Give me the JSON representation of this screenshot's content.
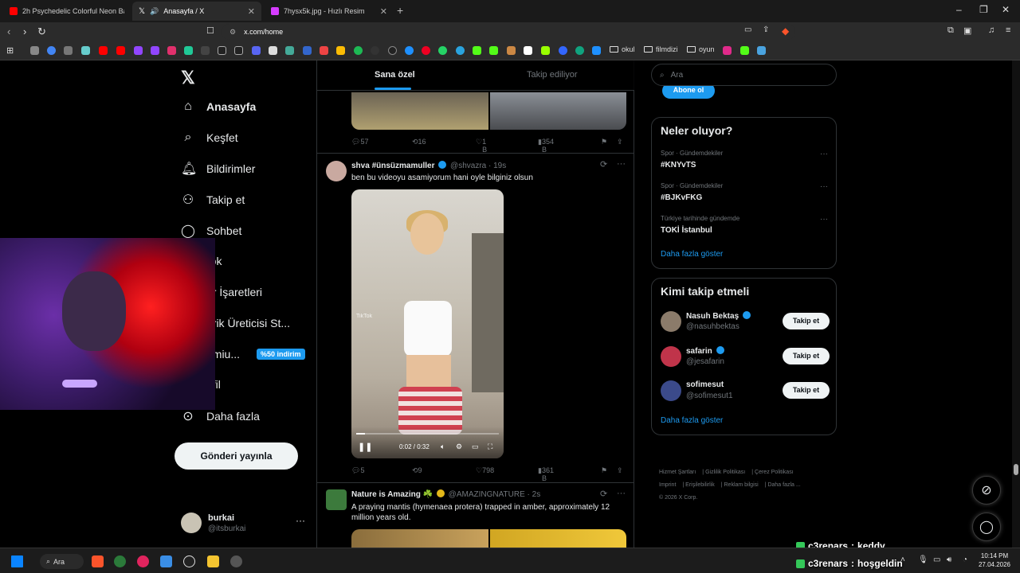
{
  "browser": {
    "tabs": [
      {
        "title": "2h Psychedelic Colorful Neon Backgr",
        "color": "#ff0000"
      },
      {
        "title": "Anasayfa / X",
        "color": "#ffffff"
      },
      {
        "title": "7hysx5k.jpg - Hızlı Resim",
        "color": "#d63cff"
      }
    ],
    "url": "x.com/home",
    "bookmark_folders": [
      "okul",
      "filmdizi",
      "oyun"
    ]
  },
  "sidebar": {
    "logo": "𝕏",
    "items": [
      {
        "label": "Anasayfa",
        "icon": "home-icon"
      },
      {
        "label": "Keşfet",
        "icon": "search-icon"
      },
      {
        "label": "Bildirimler",
        "icon": "bell-icon"
      },
      {
        "label": "Takip et",
        "icon": "follow-icon"
      },
      {
        "label": "Sohbet",
        "icon": "chat-icon"
      },
      {
        "label": "rok",
        "icon": "grok-icon"
      },
      {
        "label": "er İşaretleri",
        "icon": "bookmark-icon"
      },
      {
        "label": "erik Üreticisi St...",
        "icon": "creator-icon"
      },
      {
        "label": "emiu...",
        "icon": "premium-icon"
      },
      {
        "label": "ofil",
        "icon": "profile-icon"
      },
      {
        "label": "Daha fazla",
        "icon": "more-icon"
      }
    ],
    "premium_badge": "%50 indirim",
    "post_button": "Gönderi yayınla",
    "account": {
      "name": "burkai",
      "handle": "@itsburkai"
    }
  },
  "timeline": {
    "tabs": [
      "Sana özel",
      "Takip ediliyor"
    ],
    "prev_tweet_stats": {
      "replies": "57",
      "reposts": "16",
      "likes": "1 B",
      "views": "354 B"
    },
    "tweet1": {
      "name": "shva #ünsüzmamuller",
      "handle": "@shvazra · 19s",
      "text": "ben bu videoyu asamiyorum hani oyle bilginiz olsun",
      "video_watermark": "TikTok",
      "video_time": "0:02 / 0:32",
      "video_progress": 0.06,
      "stats": {
        "replies": "5",
        "reposts": "9",
        "likes": "798",
        "views": "361 B"
      }
    },
    "tweet2": {
      "name": "Nature is Amazing ☘️",
      "handle": "@AMAZINGNATURE · 2s",
      "text": "A praying mantis (hymenaea protera) trapped in amber, approximately 12 million years old."
    }
  },
  "right": {
    "search_placeholder": "Ara",
    "subscribe": "Abone ol",
    "trends_title": "Neler oluyor?",
    "trends": [
      {
        "context": "Spor · Gündemdekiler",
        "title": "#KNYvTS"
      },
      {
        "context": "Spor · Gündemdekiler",
        "title": "#BJKvFKG"
      },
      {
        "context": "Türkiye tarihinde gündemde",
        "title": "TOKİ İstanbul"
      }
    ],
    "show_more": "Daha fazla göster",
    "who_title": "Kimi takip etmeli",
    "who": [
      {
        "name": "Nasuh Bektaş",
        "handle": "@nasuhbektas",
        "button": "Takip et"
      },
      {
        "name": "safarin",
        "handle": "@jesafarin",
        "button": "Takip et"
      },
      {
        "name": "sofimesut",
        "handle": "@sofimesut1",
        "button": "Takip et"
      }
    ],
    "footer": [
      "Hizmet Şartları",
      "Gizlilik Politikası",
      "Çerez Politikası",
      "Imprint",
      "Erişilebilirlik",
      "Reklam bilgisi",
      "Daha fazla ...",
      "© 2026 X Corp."
    ]
  },
  "chat_overlay": [
    {
      "user": "c3renars",
      "message": "keddy"
    },
    {
      "user": "c3renars",
      "message": "hoşgeldin"
    }
  ],
  "taskbar": {
    "search": "Ara",
    "time": "10:14 PM",
    "date": "27.04.2026"
  }
}
